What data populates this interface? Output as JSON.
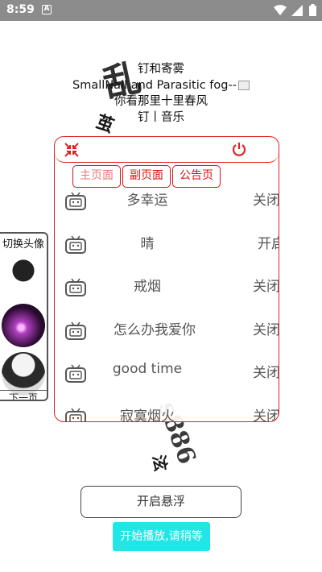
{
  "statusbar": {
    "time": "8:59",
    "notif_letter": "A"
  },
  "background_text": [
    "乱",
    "茧",
    "s886",
    "泫"
  ],
  "song_info": {
    "line1": "钉和寄雾",
    "line2": "SmallNail and Parasitic fog--",
    "line3": "你看那里十里春风",
    "line4": "钉丨音乐"
  },
  "side_panel": {
    "title": "切换头像",
    "next_label": "下一页"
  },
  "main_panel": {
    "accent_color": "#e02020",
    "tabs": [
      {
        "label": "主页面",
        "active": true
      },
      {
        "label": "副页面",
        "active": false
      },
      {
        "label": "公告页",
        "active": false
      }
    ],
    "rows": [
      {
        "name": "多幸运",
        "state": "关闭"
      },
      {
        "name": "晴",
        "state": "开启"
      },
      {
        "name": "戒烟",
        "state": "关闭"
      },
      {
        "name": "怎么办我爱你",
        "state": "关闭"
      },
      {
        "name": "good time",
        "state": "关闭"
      },
      {
        "name": "寂寞烟火",
        "state": "关闭"
      }
    ]
  },
  "buttons": {
    "float_label": "开启悬浮",
    "play_label": "开始播放,请稍等",
    "play_color": "#22e6e6"
  }
}
